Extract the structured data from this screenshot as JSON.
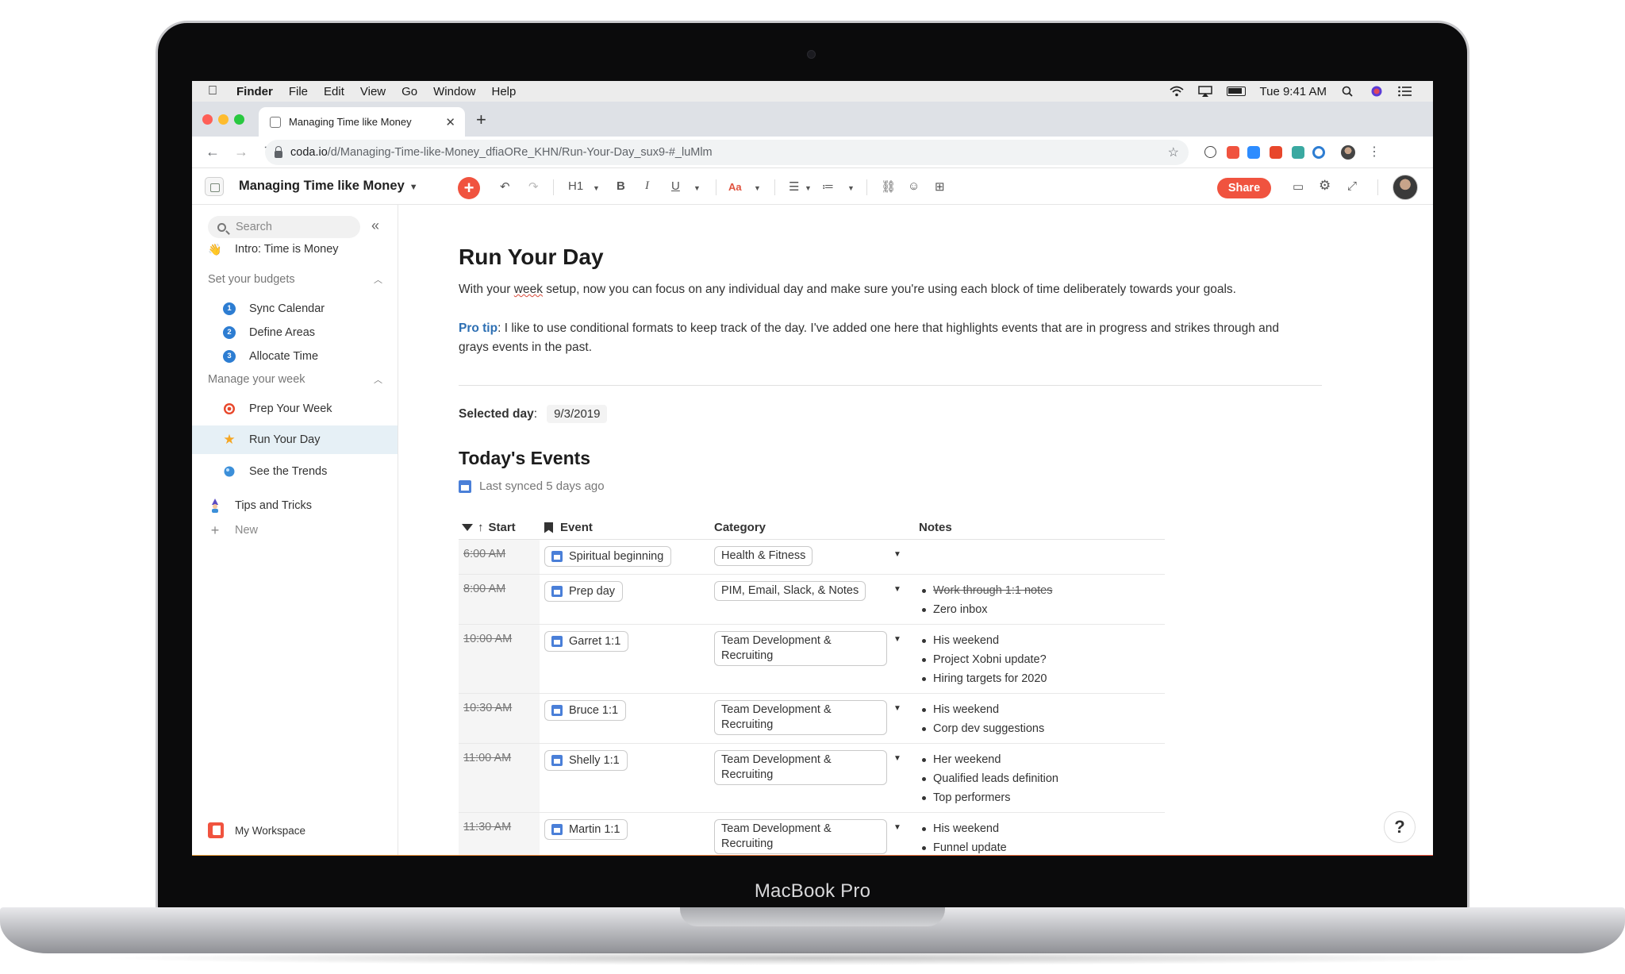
{
  "device": {
    "brand": "MacBook Pro"
  },
  "menubar": {
    "app": "Finder",
    "items": [
      "File",
      "Edit",
      "View",
      "Go",
      "Window",
      "Help"
    ],
    "clock": "Tue 9:41 AM"
  },
  "browser": {
    "tab_title": "Managing Time like Money",
    "url_host": "coda.io",
    "url_path": "/d/Managing-Time-like-Money_dfiaORe_KHN/Run-Your-Day_sux9-#_luMlm"
  },
  "toolbar": {
    "doc_title": "Managing Time like Money",
    "heading_label": "H1",
    "bold_label": "B",
    "italic_label": "I",
    "underline_label": "U",
    "font_label": "Aa",
    "share_label": "Share"
  },
  "sidebar": {
    "search_placeholder": "Search",
    "intro": "Intro: Time is Money",
    "section1": "Set your budgets",
    "budget_items": [
      {
        "num": "1",
        "label": "Sync Calendar"
      },
      {
        "num": "2",
        "label": "Define Areas"
      },
      {
        "num": "3",
        "label": "Allocate Time"
      }
    ],
    "section2": "Manage your week",
    "week_items": [
      "Prep Your Week",
      "Run Your Day",
      "See the Trends"
    ],
    "tips": "Tips and Tricks",
    "new": "New",
    "workspace": "My Workspace"
  },
  "page": {
    "title": "Run Your Day",
    "intro_before": "With your ",
    "intro_week": "week",
    "intro_after": " setup, now you can focus on any individual day and make sure you're using each block of time deliberately towards your goals.",
    "protip_label": "Pro tip",
    "protip_text": ": I like to use conditional formats to keep track of the day. I've added one here that highlights events that are in progress and strikes through and grays events in the past.",
    "selected_label": "Selected day",
    "selected_value": "9/3/2019",
    "events_title": "Today's Events",
    "synced": "Last synced 5 days ago"
  },
  "table": {
    "headers": {
      "start": "Start",
      "event": "Event",
      "category": "Category",
      "notes": "Notes"
    },
    "rows": [
      {
        "start": "6:00 AM",
        "event": "Spiritual beginning",
        "category": "Health & Fitness",
        "notes": [],
        "strike_notes": []
      },
      {
        "start": "8:00 AM",
        "event": "Prep day",
        "category": "PIM, Email, Slack, & Notes",
        "notes": [
          "Zero inbox"
        ],
        "strike_notes": [
          "Work through 1:1 notes"
        ]
      },
      {
        "start": "10:00 AM",
        "event": "Garret 1:1",
        "category": "Team Development & Recruiting",
        "notes": [
          "His weekend",
          "Project Xobni update?",
          "Hiring targets for 2020"
        ],
        "strike_notes": []
      },
      {
        "start": "10:30 AM",
        "event": "Bruce 1:1",
        "category": "Team Development & Recruiting",
        "notes": [
          "His weekend",
          "Corp dev suggestions"
        ],
        "strike_notes": []
      },
      {
        "start": "11:00 AM",
        "event": "Shelly 1:1",
        "category": "Team Development & Recruiting",
        "notes": [
          "Her weekend",
          "Qualified leads definition",
          "Top performers"
        ],
        "strike_notes": []
      },
      {
        "start": "11:30 AM",
        "event": "Martin 1:1",
        "category": "Team Development & Recruiting",
        "notes": [
          "His weekend",
          "Funnel update"
        ],
        "strike_notes": []
      }
    ]
  }
}
